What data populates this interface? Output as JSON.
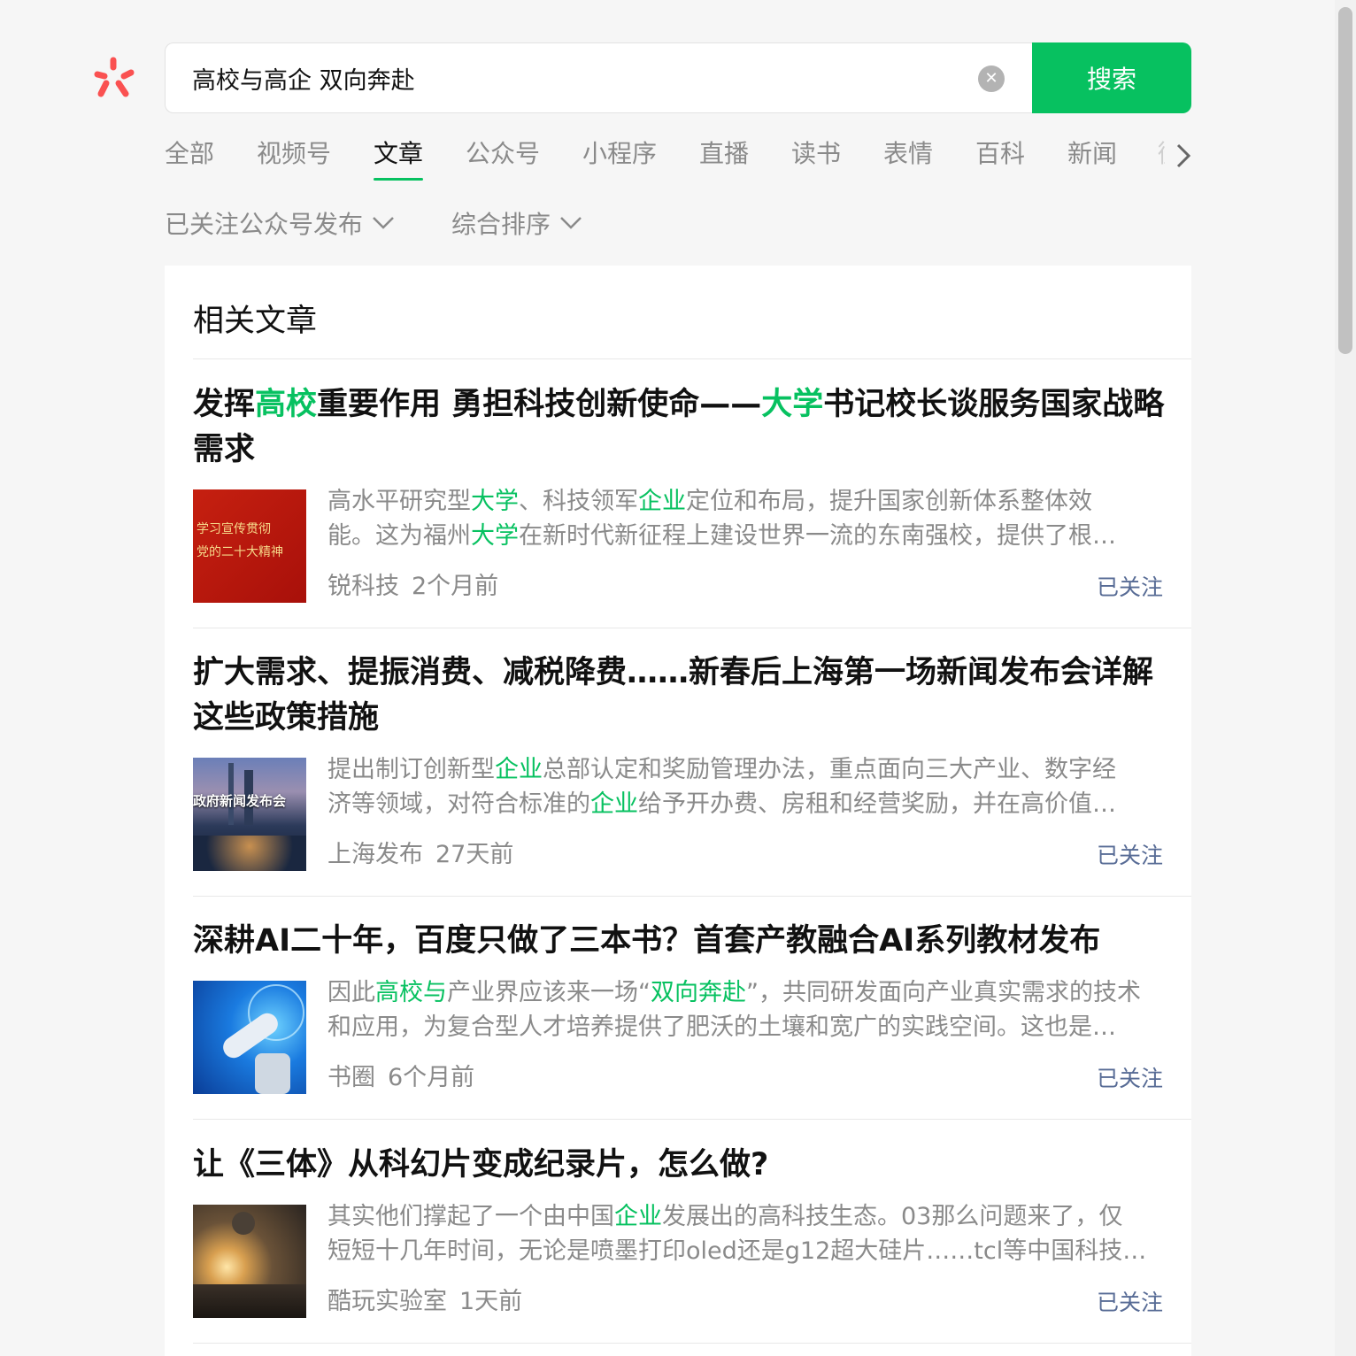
{
  "search": {
    "query": "高校与高企 双向奔赴",
    "clear_icon": "close-circle-icon",
    "button_label": "搜索"
  },
  "tabs": [
    {
      "label": "全部"
    },
    {
      "label": "视频号"
    },
    {
      "label": "文章",
      "active": true
    },
    {
      "label": "公众号"
    },
    {
      "label": "小程序"
    },
    {
      "label": "直播"
    },
    {
      "label": "读书"
    },
    {
      "label": "表情"
    },
    {
      "label": "百科"
    },
    {
      "label": "新闻"
    },
    {
      "label": "微"
    }
  ],
  "filters": {
    "source": "已关注公众号发布",
    "sort": "综合排序"
  },
  "section_title": "相关文章",
  "articles": [
    {
      "title_parts": [
        {
          "t": "发挥"
        },
        {
          "t": "高校",
          "hl": true
        },
        {
          "t": "重要作用 勇担科技创新使命——"
        },
        {
          "t": "大学",
          "hl": true
        },
        {
          "t": "书记校长谈服务国家战略需求"
        }
      ],
      "summary_lines": [
        [
          {
            "t": "高水平研究型"
          },
          {
            "t": "大学",
            "hl": true
          },
          {
            "t": "、科技领军"
          },
          {
            "t": "企业",
            "hl": true
          },
          {
            "t": "定位和布局，提升国家创新体系整体效"
          }
        ],
        [
          {
            "t": "能。这为福州"
          },
          {
            "t": "大学",
            "hl": true
          },
          {
            "t": "在新时代新征程上建设世界一流的东南强校，提供了根…"
          }
        ]
      ],
      "source": "锐科技",
      "time": "2个月前",
      "follow": "已关注",
      "thumb_text": [
        "学习宣传贯彻",
        "党的二十大精神"
      ]
    },
    {
      "title_parts": [
        {
          "t": "扩大需求、提振消费、减税降费……新春后上海第一场新闻发布会详解这些政策措施"
        }
      ],
      "summary_lines": [
        [
          {
            "t": "提出制订创新型"
          },
          {
            "t": "企业",
            "hl": true
          },
          {
            "t": "总部认定和奖励管理办法，重点面向三大产业、数字经"
          }
        ],
        [
          {
            "t": "济等领域，对符合标准的"
          },
          {
            "t": "企业",
            "hl": true
          },
          {
            "t": "给予开办费、房租和经营奖励，并在高价值…"
          }
        ]
      ],
      "source": "上海发布",
      "time": "27天前",
      "follow": "已关注",
      "thumb_text": [
        "政府新闻发布会"
      ]
    },
    {
      "title_parts": [
        {
          "t": "深耕AI二十年，百度只做了三本书？首套产教融合AI系列教材发布"
        }
      ],
      "summary_lines": [
        [
          {
            "t": "因此"
          },
          {
            "t": "高校与",
            "hl": true
          },
          {
            "t": "产业界应该来一场“"
          },
          {
            "t": "双向奔赴",
            "hl": true
          },
          {
            "t": "”，共同研发面向产业真实需求的技术"
          }
        ],
        [
          {
            "t": "和应用，为复合型人才培养提供了肥沃的土壤和宽广的实践空间。这也是…"
          }
        ]
      ],
      "source": "书圈",
      "time": "6个月前",
      "follow": "已关注",
      "thumb_text": []
    },
    {
      "title_parts": [
        {
          "t": "让《三体》从科幻片变成纪录片，怎么做?"
        }
      ],
      "summary_lines": [
        [
          {
            "t": "其实他们撑起了一个由中国"
          },
          {
            "t": "企业",
            "hl": true
          },
          {
            "t": "发展出的高科技生态。03那么问题来了，仅"
          }
        ],
        [
          {
            "t": "短短十几年时间，无论是喷墨打印oled还是g12超大硅片……tcl等中国科技…"
          }
        ]
      ],
      "source": "酷玩实验室",
      "time": "1天前",
      "follow": "已关注",
      "thumb_text": []
    }
  ],
  "colors": {
    "accent": "#07c160",
    "follow_link": "#576b95",
    "muted_text": "#8a8a8a",
    "page_bg": "#f6f6f6"
  },
  "icons": {
    "logo": "wechat-search-logo-icon",
    "tabs_more": "chevron-right-icon",
    "filter_dropdown": "chevron-down-icon"
  }
}
